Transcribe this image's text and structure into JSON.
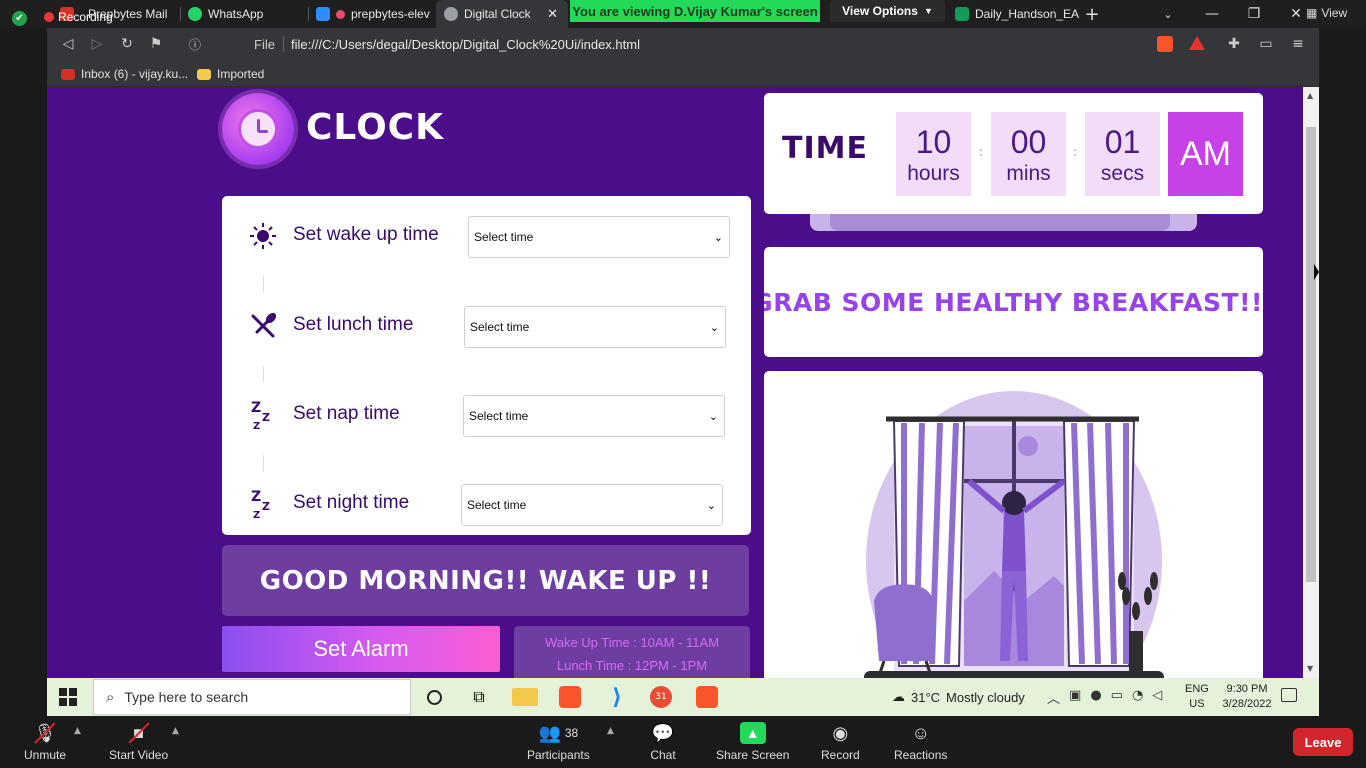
{
  "browser": {
    "tabs": [
      {
        "label": "Prepbytes Mail",
        "favicon_color": "#d93025"
      },
      {
        "label": "WhatsApp",
        "favicon_color": "#25d366"
      },
      {
        "label": "prepbytes-elev",
        "favicon_color": "#2d8cff"
      },
      {
        "label": "Digital Clock",
        "favicon_color": "#9aa0a6",
        "active": true
      },
      {
        "label": "Daily_Handson_EA",
        "favicon_color": "#0f9d58"
      }
    ],
    "recording_label": "Recording",
    "viewing_banner": "You are viewing D.Vijay Kumar's screen",
    "view_options_label": "View Options",
    "zoom_view_label": "View",
    "url_scheme_label": "File",
    "url": "file:///C:/Users/degal/Desktop/Digital_Clock%20Ui/index.html",
    "bookmarks": [
      {
        "label": "Inbox (6) - vijay.ku...",
        "icon": "gmail-icon"
      },
      {
        "label": "Imported",
        "icon": "folder-icon"
      }
    ]
  },
  "page": {
    "logo_text": "CLOCK",
    "time_label": "TIME",
    "time": {
      "hours": "10",
      "hours_unit": "hours",
      "mins": "00",
      "mins_unit": "mins",
      "secs": "01",
      "secs_unit": "secs",
      "ampm": "AM",
      "colon": ":"
    },
    "rows": [
      {
        "label": "Set wake up time",
        "icon": "sun-icon",
        "select": "Select time"
      },
      {
        "label": "Set lunch time",
        "icon": "fork-spoon-icon",
        "select": "Select time"
      },
      {
        "label": "Set nap time",
        "icon": "zzz-icon",
        "select": "Select time"
      },
      {
        "label": "Set night time",
        "icon": "zzz-icon",
        "select": "Select time"
      }
    ],
    "greeting": "GOOD MORNING!! WAKE UP !!",
    "set_alarm_label": "Set Alarm",
    "schedule": [
      "Wake Up Time : 10AM - 11AM",
      "Lunch Time : 12PM - 1PM"
    ],
    "message": "GRAB SOME HEALTHY BREAKFAST!!!",
    "colors": {
      "background": "#4b0d8a",
      "accent": "#c642e6",
      "text_dark": "#3a0a6b",
      "message": "#9743e9"
    }
  },
  "taskbar": {
    "search_placeholder": "Type here to search",
    "weather_temp": "31°C",
    "weather_text": "Mostly cloudy",
    "lang_line1": "ENG",
    "lang_line2": "US",
    "time": "9:30 PM",
    "date": "3/28/2022",
    "badge_count": "31"
  },
  "zoom": {
    "unmute_label": "Unmute",
    "start_video_label": "Start Video",
    "participants_label": "Participants",
    "participants_count": "38",
    "chat_label": "Chat",
    "share_screen_label": "Share Screen",
    "record_label": "Record",
    "reactions_label": "Reactions",
    "leave_label": "Leave"
  }
}
